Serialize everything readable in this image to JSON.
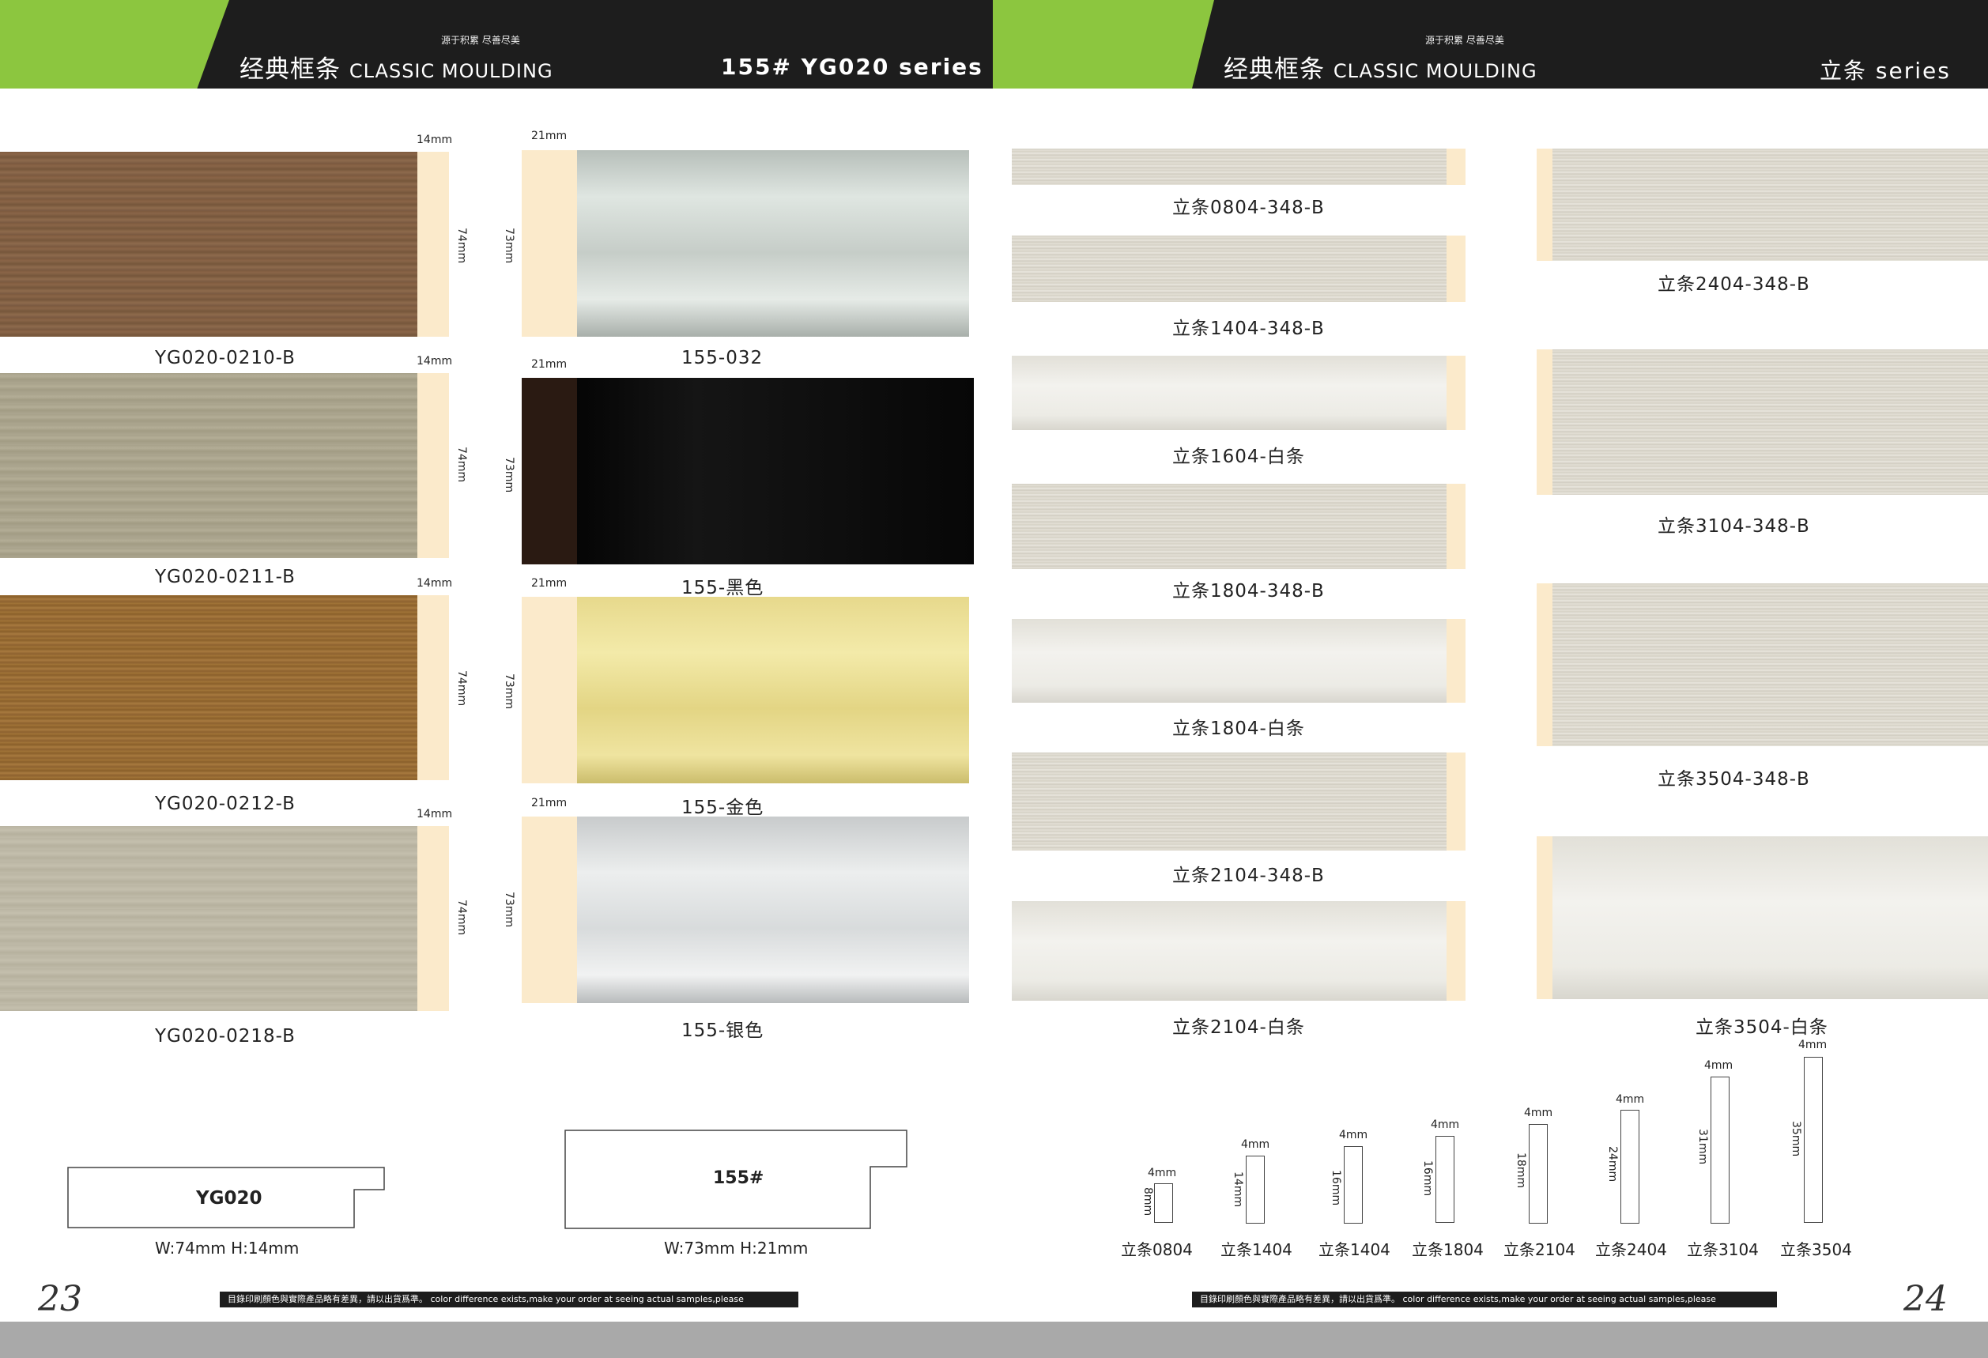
{
  "header_left": {
    "slogan": "源于积累 尽善尽美",
    "title_cn": "经典框条",
    "title_en": "CLASSIC MOULDING",
    "series": "155#  YG020   series"
  },
  "header_right": {
    "slogan": "源于积累 尽善尽美",
    "title_cn": "经典框条",
    "title_en": "CLASSIC MOULDING",
    "series": "立条 series"
  },
  "yg020_items": [
    {
      "code": "YG020-0210-B",
      "width": "14mm",
      "height": "74mm"
    },
    {
      "code": "YG020-0211-B",
      "width": "14mm",
      "height": "74mm"
    },
    {
      "code": "YG020-0212-B",
      "width": "14mm",
      "height": "74mm"
    },
    {
      "code": "YG020-0218-B",
      "width": "14mm",
      "height": "74mm"
    }
  ],
  "s155_items": [
    {
      "code": "155-032",
      "width": "21mm",
      "height": "73mm"
    },
    {
      "code": "155-黑色",
      "width": "21mm",
      "height": "73mm"
    },
    {
      "code": "155-金色",
      "width": "21mm",
      "height": "73mm"
    },
    {
      "code": "155-银色",
      "width": "21mm",
      "height": "73mm"
    }
  ],
  "profiles": {
    "yg020": {
      "name": "YG020",
      "dims": "W:74mm   H:14mm"
    },
    "s155": {
      "name": "155#",
      "dims": "W:73mm   H:21mm"
    }
  },
  "litiao_left": [
    "立条0804-348-B",
    "立条1404-348-B",
    "立条1604-白条",
    "立条1804-348-B",
    "立条1804-白条",
    "立条2104-348-B",
    "立条2104-白条"
  ],
  "litiao_right": [
    "立条2404-348-B",
    "立条3104-348-B",
    "立条3504-348-B",
    "立条3504-白条"
  ],
  "litiao_dims": [
    {
      "name": "立条0804",
      "w": "4mm",
      "h": "8mm"
    },
    {
      "name": "立条1404",
      "w": "4mm",
      "h": "14mm"
    },
    {
      "name": "立条1404",
      "w": "4mm",
      "h": "16mm"
    },
    {
      "name": "立条1804",
      "w": "4mm",
      "h": "16mm"
    },
    {
      "name": "立条2104",
      "w": "4mm",
      "h": "18mm"
    },
    {
      "name": "立条2404",
      "w": "4mm",
      "h": "24mm"
    },
    {
      "name": "立条3104",
      "w": "4mm",
      "h": "31mm"
    },
    {
      "name": "立条3504",
      "w": "4mm",
      "h": "35mm"
    }
  ],
  "footer": {
    "disclaimer": "目錄印刷顏色與實際產品略有差異，請以出貨爲準。 color difference exists,make your order at seeing actual samples,please",
    "page_left": "23",
    "page_right": "24"
  },
  "colors": {
    "accent_green": "#8cc63f",
    "header_black": "#1d1d1d",
    "cream": "#fbeacb"
  }
}
